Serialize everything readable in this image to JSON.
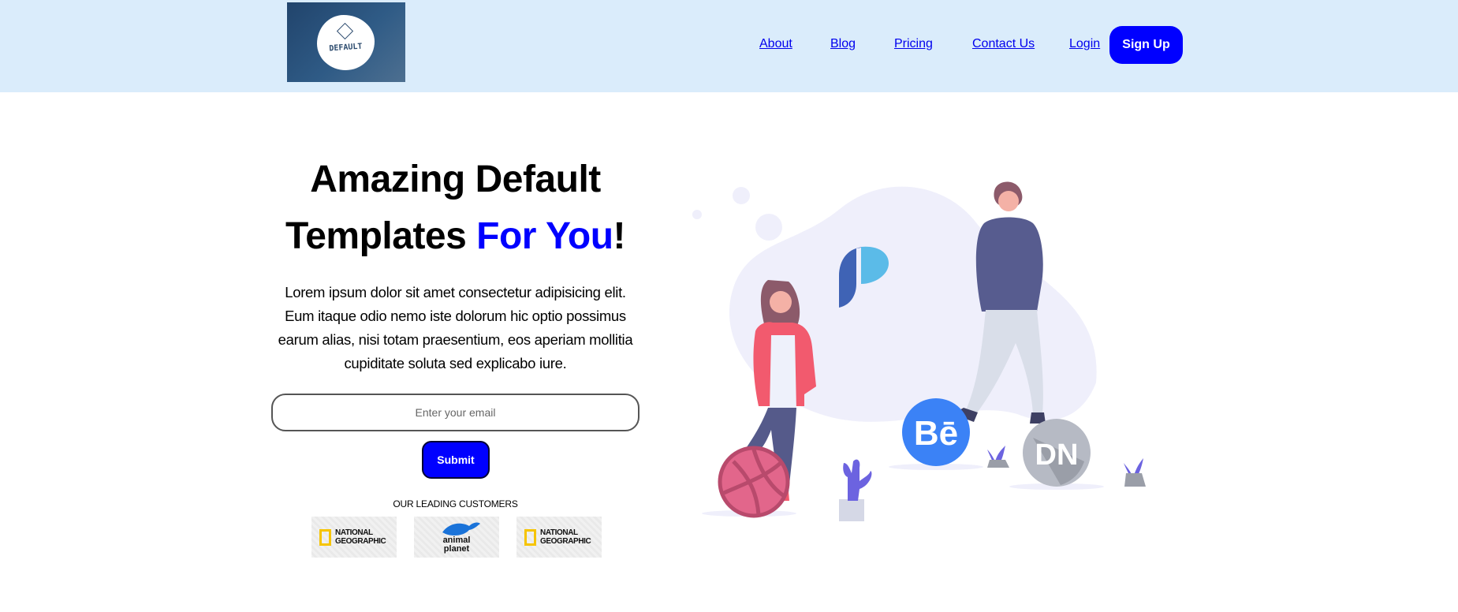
{
  "header": {
    "logo_text": "DEFAULT",
    "nav": [
      {
        "label": "About"
      },
      {
        "label": "Blog"
      },
      {
        "label": "Pricing"
      },
      {
        "label": "Contact Us"
      },
      {
        "label": "Login"
      }
    ],
    "signup_label": "Sign Up"
  },
  "hero": {
    "title_line1": "Amazing Default",
    "title_line2_pre": "Templates ",
    "title_accent": "For You",
    "title_end": "!",
    "description": "Lorem ipsum dolor sit amet consectetur adipisicing elit. Eum itaque odio nemo iste dolorum hic optio possimus earum alias, nisi totam praesentium, eos aperiam mollitia cupiditate soluta sed explicabo iure.",
    "email_placeholder": "Enter your email",
    "submit_label": "Submit",
    "customers_label": "OUR LEADING CUSTOMERS",
    "customers": [
      {
        "line1": "NATIONAL",
        "line2": "GEOGRAPHIC"
      },
      {
        "line1": "animal",
        "line2": "planet"
      },
      {
        "line1": "NATIONAL",
        "line2": "GEOGRAPHIC"
      }
    ]
  },
  "illustration": {
    "badges": [
      "Bē",
      "DN"
    ]
  },
  "colors": {
    "header_bg": "#daecfb",
    "accent": "#0000ff",
    "blob": "#efeffb"
  }
}
